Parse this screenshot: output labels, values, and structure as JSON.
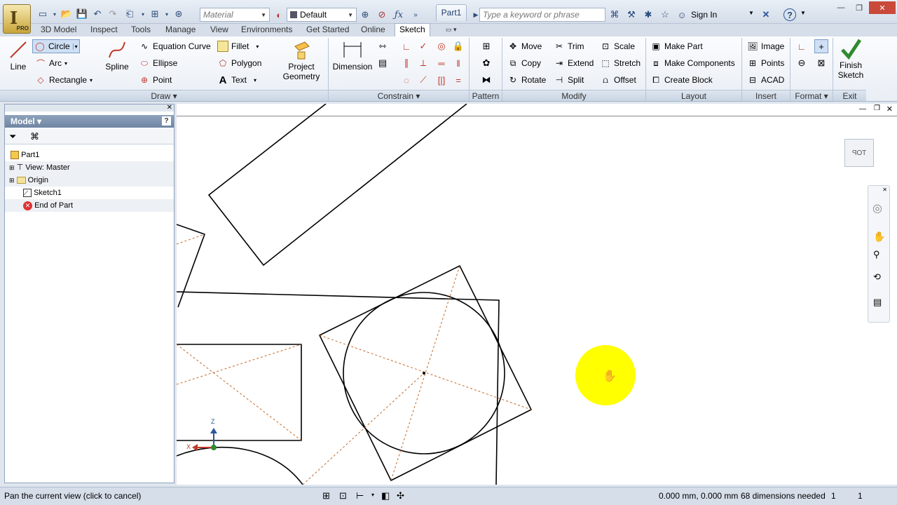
{
  "app": {
    "part_tab": "Part1",
    "brand": "I",
    "edition": "PRO"
  },
  "quick_access": {
    "material_placeholder": "Material",
    "appearance_value": "Default"
  },
  "search": {
    "placeholder": "Type a keyword or phrase"
  },
  "account": {
    "sign_in": "Sign In"
  },
  "tabs": [
    "3D Model",
    "Inspect",
    "Tools",
    "Manage",
    "View",
    "Environments",
    "Get Started",
    "Online",
    "Sketch"
  ],
  "active_tab": "Sketch",
  "ribbon": {
    "draw": {
      "line": "Line",
      "circle": "Circle",
      "arc": "Arc",
      "rectangle": "Rectangle",
      "spline": "Spline",
      "equation_curve": "Equation Curve",
      "ellipse": "Ellipse",
      "point": "Point",
      "fillet": "Fillet",
      "polygon": "Polygon",
      "text": "Text",
      "project_geometry_1": "Project",
      "project_geometry_2": "Geometry",
      "title": "Draw"
    },
    "constrain": {
      "dimension": "Dimension",
      "title": "Constrain"
    },
    "pattern": {
      "title": "Pattern"
    },
    "modify": {
      "move": "Move",
      "copy": "Copy",
      "rotate": "Rotate",
      "trim": "Trim",
      "extend": "Extend",
      "split": "Split",
      "scale": "Scale",
      "stretch": "Stretch",
      "offset": "Offset",
      "title": "Modify"
    },
    "layout": {
      "make_part": "Make Part",
      "make_components": "Make Components",
      "create_block": "Create Block",
      "title": "Layout"
    },
    "insert": {
      "image": "Image",
      "points": "Points",
      "acad": "ACAD",
      "title": "Insert"
    },
    "format": {
      "title": "Format"
    },
    "exit": {
      "finish_1": "Finish",
      "finish_2": "Sketch",
      "title": "Exit"
    }
  },
  "browser": {
    "title": "Model",
    "tree": [
      {
        "label": "Part1"
      },
      {
        "label": "View: Master"
      },
      {
        "label": "Origin"
      },
      {
        "label": "Sketch1"
      },
      {
        "label": "End of Part"
      }
    ]
  },
  "viewcube": {
    "label": "TOP"
  },
  "triad": {
    "z": "Z",
    "x": "X"
  },
  "status": {
    "message": "Pan the current view (click to cancel)",
    "coordinates": "0.000 mm, 0.000 mm",
    "dimensions_needed": "68 dimensions needed",
    "count1": "1",
    "count2": "1"
  },
  "colors": {
    "accent": "#2b579a",
    "highlight": "#ffff00",
    "finish_check": "#2e8b2e",
    "construction": "#c46a2a"
  }
}
